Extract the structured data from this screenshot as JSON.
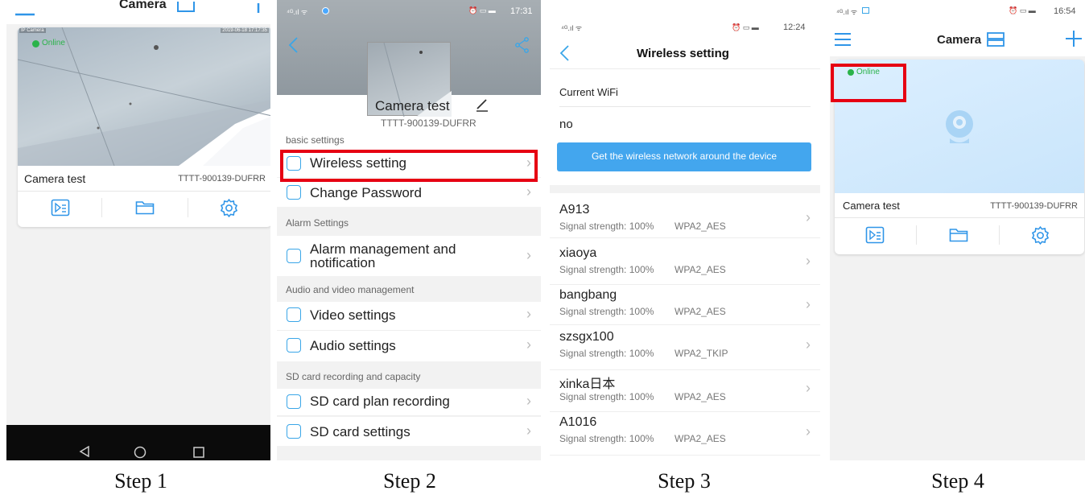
{
  "colors": {
    "accent": "#2f95e8",
    "online": "#2bb34a",
    "highlight": "#e60012",
    "wifi_button": "#43a6ee"
  },
  "captions": [
    "Step 1",
    "Step 2",
    "Step 3",
    "Step 4"
  ],
  "panel1": {
    "header_title": "Camera",
    "overlay_label": "IP Camera",
    "timestamp": "2019-06-18 17:17:35",
    "status": "Online",
    "device_name": "Camera test",
    "device_id": "TTTT-900139-DUFRR",
    "icons": [
      "playback-icon",
      "folder-icon",
      "settings-icon"
    ]
  },
  "panel2": {
    "time": "17:31",
    "device_name": "Camera test",
    "device_id": "TTTT-900139-DUFRR",
    "sections": {
      "basic": "basic settings",
      "alarm": "Alarm Settings",
      "av": "Audio and video management",
      "sd": "SD card recording and capacity"
    },
    "items": {
      "wireless": "Wireless setting",
      "password": "Change Password",
      "alarm_line1": "Alarm management and",
      "alarm_line2": "notification",
      "video": "Video settings",
      "audio": "Audio settings",
      "sd_plan": "SD card plan recording",
      "sd_settings": "SD card settings"
    }
  },
  "panel3": {
    "time": "12:24",
    "title": "Wireless setting",
    "current_label": "Current WiFi",
    "current_value": "no",
    "button_label": "Get the wireless network around the device",
    "networks": [
      {
        "name": "A913",
        "signal": "Signal strength: 100%",
        "encryption": "WPA2_AES"
      },
      {
        "name": "xiaoya",
        "signal": "Signal strength: 100%",
        "encryption": "WPA2_AES"
      },
      {
        "name": "bangbang",
        "signal": "Signal strength: 100%",
        "encryption": "WPA2_AES"
      },
      {
        "name": "szsgx100",
        "signal": "Signal strength: 100%",
        "encryption": "WPA2_TKIP"
      },
      {
        "name": "xinka日本",
        "signal": "Signal strength: 100%",
        "encryption": "WPA2_AES"
      },
      {
        "name": "A1016",
        "signal": "Signal strength: 100%",
        "encryption": "WPA2_AES"
      }
    ]
  },
  "panel4": {
    "time": "16:54",
    "header_title": "Camera",
    "status": "Online",
    "device_name": "Camera test",
    "device_id": "TTTT-900139-DUFRR",
    "icons": [
      "playback-icon",
      "folder-icon",
      "settings-icon"
    ]
  }
}
